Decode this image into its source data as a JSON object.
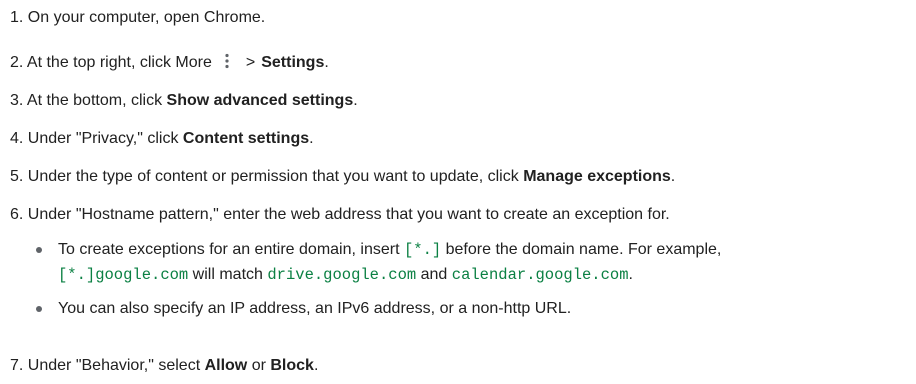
{
  "steps": [
    {
      "num": "1.",
      "text": "On your computer, open Chrome."
    },
    {
      "num": "2.",
      "pre": "At the top right, click More",
      "arrow": ">",
      "bold": "Settings",
      "post": "."
    },
    {
      "num": "3.",
      "pre": "At the bottom, click ",
      "bold": "Show advanced settings",
      "post": "."
    },
    {
      "num": "4.",
      "pre": "Under \"Privacy,\" click ",
      "bold": "Content settings",
      "post": "."
    },
    {
      "num": "5.",
      "pre": "Under the type of content or permission that you want to update, click ",
      "bold": "Manage exceptions",
      "post": "."
    },
    {
      "num": "6.",
      "text": "Under \"Hostname pattern,\" enter the web address that you want to create an exception for."
    },
    {
      "num": "7.",
      "pre": "Under \"Behavior,\" select ",
      "bold": "Allow",
      "mid": " or ",
      "bold2": "Block",
      "post": "."
    }
  ],
  "bullets": [
    {
      "pre": "To create exceptions for an entire domain, insert ",
      "code1": "[*.]",
      "mid": " before the domain name. For example,",
      "line2_code1": "[*.]google.com",
      "line2_mid": " will match ",
      "line2_code2": "drive.google.com",
      "line2_and": " and ",
      "line2_code3": "calendar.google.com",
      "line2_post": "."
    },
    {
      "text": "You can also specify an IP address, an IPv6 address, or a non-http URL."
    }
  ],
  "icons": {
    "more": "more-vert-icon"
  }
}
